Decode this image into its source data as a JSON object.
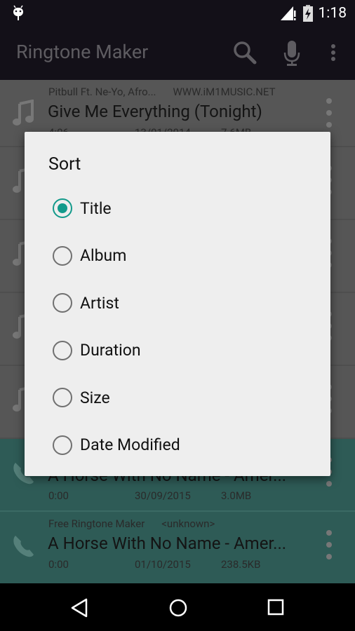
{
  "status_bar": {
    "time": "1:18",
    "icons": [
      "android-debug-icon",
      "signal-icon",
      "battery-charging-icon"
    ]
  },
  "toolbar": {
    "title": "Ringtone Maker",
    "actions": [
      "search-icon",
      "mic-icon",
      "more-vert-icon"
    ]
  },
  "rows": [
    {
      "type": "music",
      "artist": "Pitbull Ft. Ne-Yo, Afro...",
      "album": "WWW.iM1MUSIC.NET",
      "title": "Give Me Everything (Tonight)",
      "duration": "4:06",
      "date": "13/01/2014",
      "size": "7.6MB"
    },
    {
      "type": "music"
    },
    {
      "type": "music"
    },
    {
      "type": "music"
    },
    {
      "type": "music"
    },
    {
      "type": "ringtone",
      "title": "A Horse With No Name - Amer...",
      "duration": "0:00",
      "date": "30/09/2015",
      "size": "3.0MB"
    },
    {
      "type": "ringtone",
      "artist": "Free Ringtone Maker",
      "album": "<unknown>",
      "title": "A Horse With No Name - Amer...",
      "duration": "0:00",
      "date": "01/10/2015",
      "size": "238.5KB"
    }
  ],
  "dialog": {
    "title": "Sort",
    "selected": "Title",
    "options": [
      "Title",
      "Album",
      "Artist",
      "Duration",
      "Size",
      "Date Modified"
    ]
  },
  "colors": {
    "accent": "#139a8b",
    "ringtone_row": "#2e5b56"
  },
  "nav": [
    "back-icon",
    "home-icon",
    "recents-icon"
  ]
}
